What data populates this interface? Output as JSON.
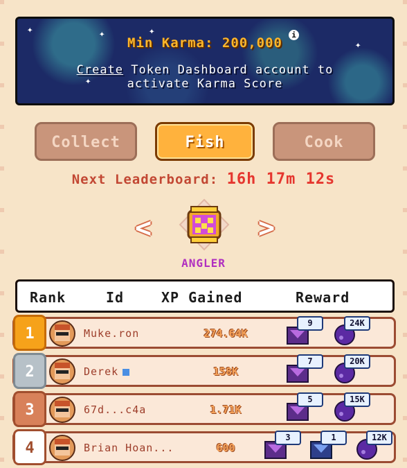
{
  "banner": {
    "karma_label": "Min Karma: 200,000",
    "info_icon": "i",
    "line1_link": "Create",
    "line1_rest": " Token Dashboard account to",
    "line2": "activate Karma Score"
  },
  "tabs": [
    {
      "label": "Collect",
      "active": false
    },
    {
      "label": "Fish",
      "active": true
    },
    {
      "label": "Cook",
      "active": false
    }
  ],
  "countdown": {
    "label": "Next Leaderboard:",
    "time": "16h 17m 12s"
  },
  "selector": {
    "name": "ANGLER",
    "left": "<",
    "right": ">"
  },
  "table": {
    "headers": [
      "Rank",
      "Id",
      "XP Gained",
      "Reward"
    ],
    "rows": [
      {
        "rank": "1",
        "id": "Muke.ron",
        "verified": false,
        "xp": "274.64K",
        "rewards": [
          {
            "type": "chest",
            "count": "9"
          },
          {
            "type": "orb",
            "count": "24K"
          }
        ]
      },
      {
        "rank": "2",
        "id": "Derek",
        "verified": true,
        "xp": "158K",
        "rewards": [
          {
            "type": "chest",
            "count": "7"
          },
          {
            "type": "orb",
            "count": "20K"
          }
        ]
      },
      {
        "rank": "3",
        "id": "67d...c4a",
        "verified": false,
        "xp": "1.71K",
        "rewards": [
          {
            "type": "chest",
            "count": "5"
          },
          {
            "type": "orb",
            "count": "15K"
          }
        ]
      },
      {
        "rank": "4",
        "id": "Brian Hoan...",
        "verified": false,
        "xp": "600",
        "rewards": [
          {
            "type": "chest",
            "count": "3"
          },
          {
            "type": "chest-blue",
            "count": "1"
          },
          {
            "type": "orb",
            "count": "12K"
          }
        ]
      }
    ]
  },
  "colors": {
    "gold": "#f6a21a",
    "silver": "#b7c1c8",
    "bronze": "#d8815a",
    "fourth": "#ffffff"
  }
}
